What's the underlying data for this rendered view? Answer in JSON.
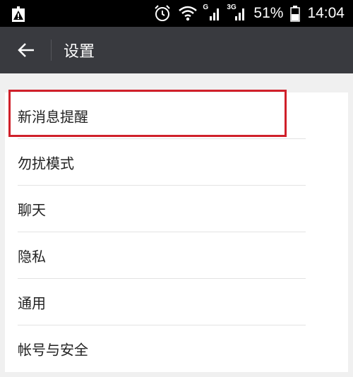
{
  "status_bar": {
    "network_1": "G",
    "network_2": "3G",
    "battery": "51%",
    "time": "14:04"
  },
  "action_bar": {
    "title": "设置"
  },
  "settings": {
    "items": [
      {
        "label": "新消息提醒"
      },
      {
        "label": "勿扰模式"
      },
      {
        "label": "聊天"
      },
      {
        "label": "隐私"
      },
      {
        "label": "通用"
      },
      {
        "label": "帐号与安全"
      }
    ],
    "highlighted_item": "新消息提醒"
  },
  "colors": {
    "status_bar_bg": "#000000",
    "action_bar_bg": "#393a3f",
    "page_bg": "#f0f0f0",
    "highlight_border": "#d0202a"
  }
}
